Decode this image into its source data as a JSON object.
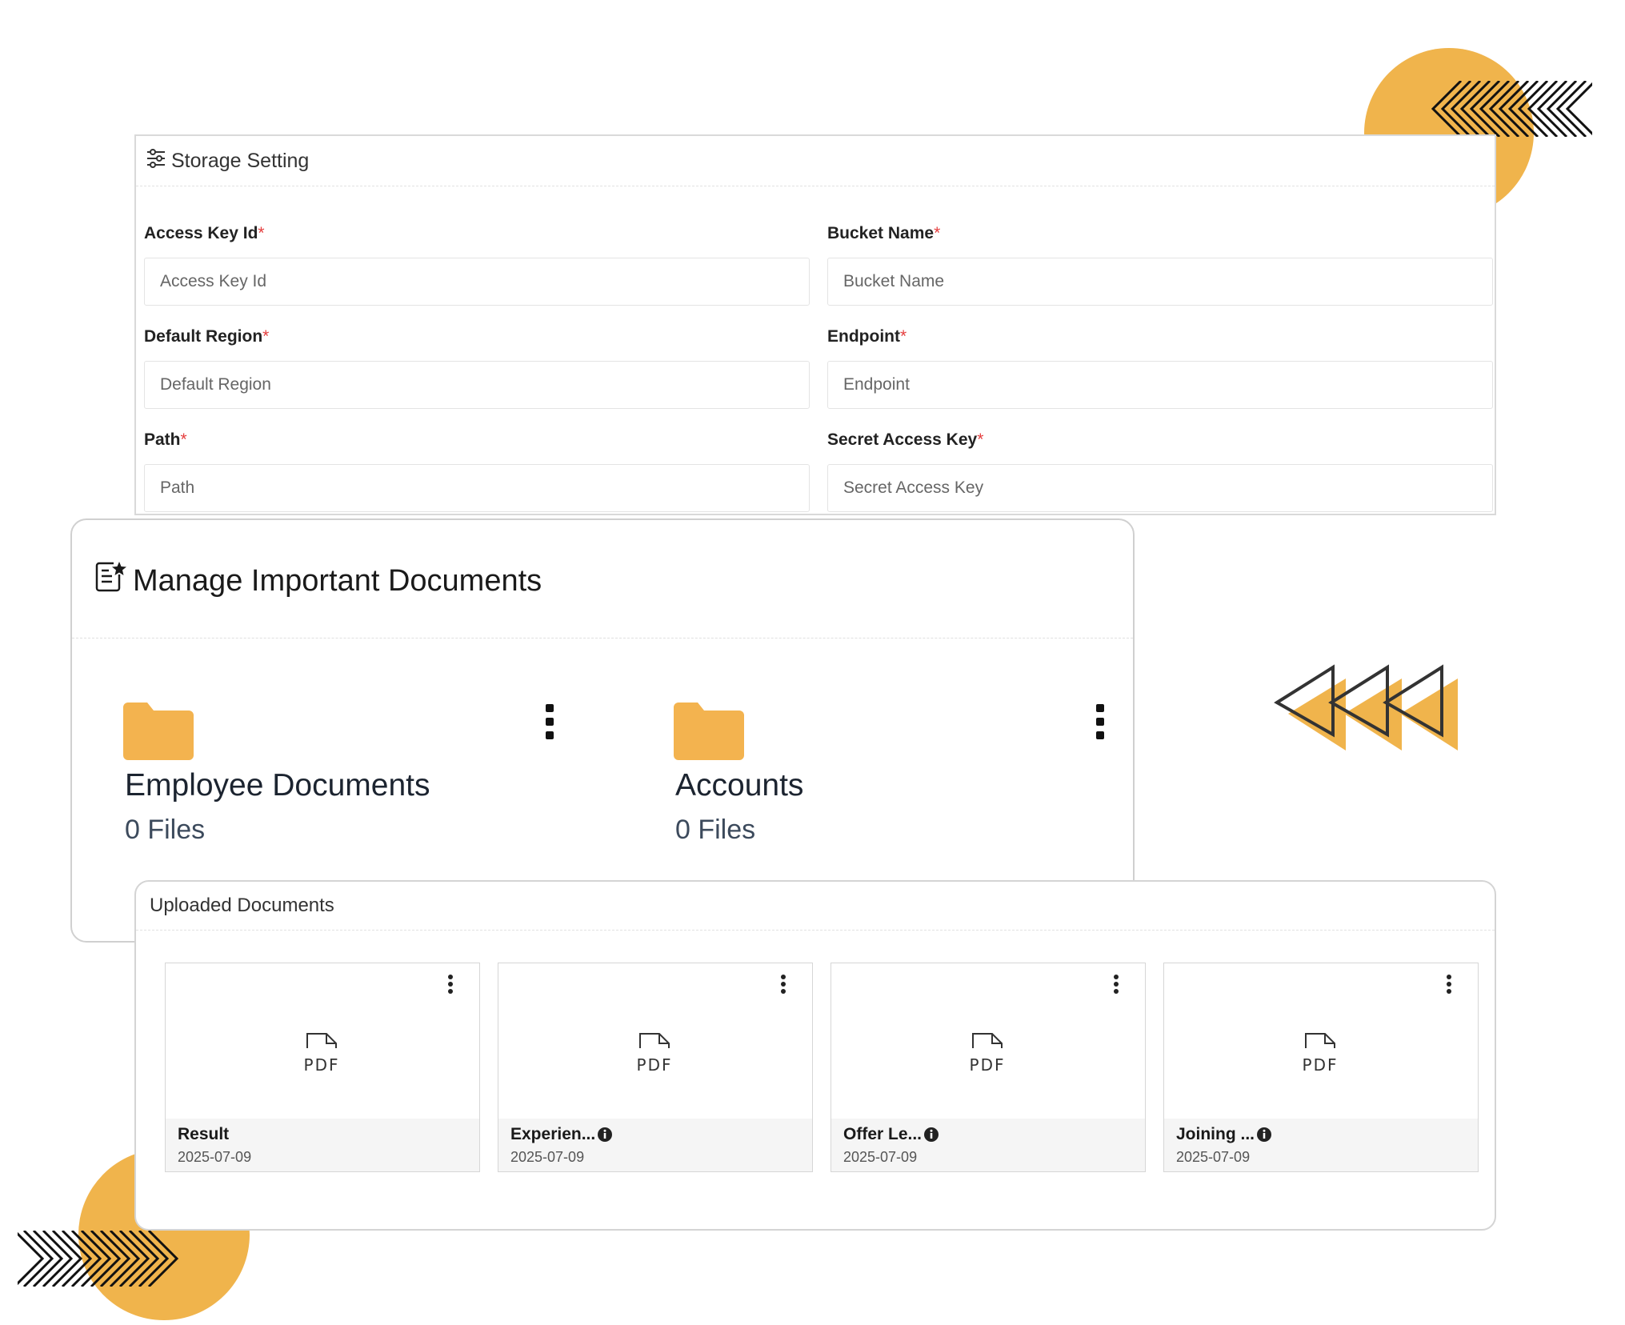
{
  "colors": {
    "accent": "#F0B44C",
    "folder": "#F3B34F",
    "required": "#e53e3e",
    "stroke": "#333333"
  },
  "storage": {
    "title": "Storage Setting",
    "icon": "sliders-icon",
    "fields": [
      {
        "label": "Access Key Id",
        "required": "*",
        "placeholder": "Access Key Id"
      },
      {
        "label": "Bucket Name",
        "required": "*",
        "placeholder": "Bucket Name"
      },
      {
        "label": "Default Region",
        "required": "*",
        "placeholder": "Default Region"
      },
      {
        "label": "Endpoint",
        "required": "*",
        "placeholder": "Endpoint"
      },
      {
        "label": "Path",
        "required": "*",
        "placeholder": "Path"
      },
      {
        "label": "Secret Access Key",
        "required": "*",
        "placeholder": "Secret Access Key"
      }
    ]
  },
  "manage": {
    "title": "Manage Important Documents",
    "icon": "document-star-icon",
    "folders": [
      {
        "name": "Employee Documents",
        "count": "0 Files"
      },
      {
        "name": "Accounts",
        "count": "0 Files"
      }
    ]
  },
  "uploaded": {
    "title": "Uploaded Documents",
    "pdf_label": "PDF",
    "docs": [
      {
        "name": "Result",
        "date": "2025-07-09"
      },
      {
        "name": "Experien...",
        "date": "2025-07-09"
      },
      {
        "name": "Offer Le...",
        "date": "2025-07-09"
      },
      {
        "name": "Joining ...",
        "date": "2025-07-09"
      }
    ]
  }
}
